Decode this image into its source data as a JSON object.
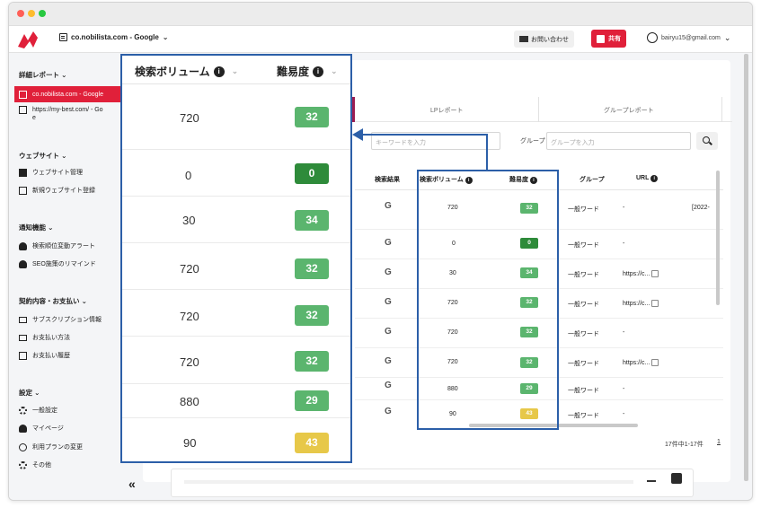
{
  "header": {
    "site_name": "co.nobilista.com - Google",
    "contact_label": "お問い合わせ",
    "share_label": "共有",
    "account_email": "bairyu15@gmail.com"
  },
  "sidebar": {
    "report_heading": "詳細レポート",
    "active_site": "co.nobilista.com - Google",
    "other_site_line1": "https://my-best.com/ - Go",
    "other_site_line2": "e",
    "website_heading": "ウェブサイト",
    "website_items": [
      "ウェブサイト管理",
      "新規ウェブサイト登録"
    ],
    "notify_heading": "通知機能",
    "notify_items": [
      "検索順位変動アラート",
      "SEO施策のリマインド"
    ],
    "contract_heading": "契約内容・お支払い",
    "contract_items": [
      "サブスクリプション情報",
      "お支払い方法",
      "お支払い履歴"
    ],
    "settings_heading": "設定",
    "settings_items": [
      "一般設定",
      "マイページ",
      "利用プランの変更",
      "その他"
    ],
    "collapse_icon": "«"
  },
  "tabs": [
    "LPレポート",
    "グループレポート"
  ],
  "filters": {
    "keyword_placeholder": "キーワードを入力",
    "group_label": "グループ",
    "group_placeholder": "グループを入力"
  },
  "table": {
    "headers": [
      "検索結果",
      "検索ボリューム",
      "難易度",
      "グループ",
      "URL"
    ],
    "rows": [
      {
        "volume": "720",
        "difficulty": "32",
        "group": "一般ワード",
        "url": "-",
        "extra": "[2022-"
      },
      {
        "volume": "0",
        "difficulty": "0",
        "group": "一般ワード",
        "url": "-",
        "extra": ""
      },
      {
        "volume": "30",
        "difficulty": "34",
        "group": "一般ワード",
        "url": "https://c...",
        "extra": ""
      },
      {
        "volume": "720",
        "difficulty": "32",
        "group": "一般ワード",
        "url": "https://c...",
        "extra": ""
      },
      {
        "volume": "720",
        "difficulty": "32",
        "group": "一般ワード",
        "url": "-",
        "extra": ""
      },
      {
        "volume": "720",
        "difficulty": "32",
        "group": "一般ワード",
        "url": "https://c...",
        "extra": ""
      },
      {
        "volume": "880",
        "difficulty": "29",
        "group": "一般ワード",
        "url": "-",
        "extra": ""
      },
      {
        "volume": "90",
        "difficulty": "43",
        "group": "一般ワード",
        "url": "-",
        "extra": ""
      }
    ],
    "pagination": "17件中1-17件",
    "page": "1"
  },
  "zoom": {
    "volume_header": "検索ボリューム",
    "difficulty_header": "難易度",
    "rows": [
      {
        "volume": "720",
        "difficulty": "32"
      },
      {
        "volume": "0",
        "difficulty": "0"
      },
      {
        "volume": "30",
        "difficulty": "34"
      },
      {
        "volume": "720",
        "difficulty": "32"
      },
      {
        "volume": "720",
        "difficulty": "32"
      },
      {
        "volume": "720",
        "difficulty": "32"
      },
      {
        "volume": "880",
        "difficulty": "29"
      },
      {
        "volume": "90",
        "difficulty": "43"
      }
    ]
  },
  "colors": {
    "brand_red": "#e0203a",
    "badge_green": "#5bb56e",
    "badge_dark_green": "#2e8b3a",
    "badge_yellow": "#e7c849",
    "highlight_blue": "#2c5fa8"
  }
}
